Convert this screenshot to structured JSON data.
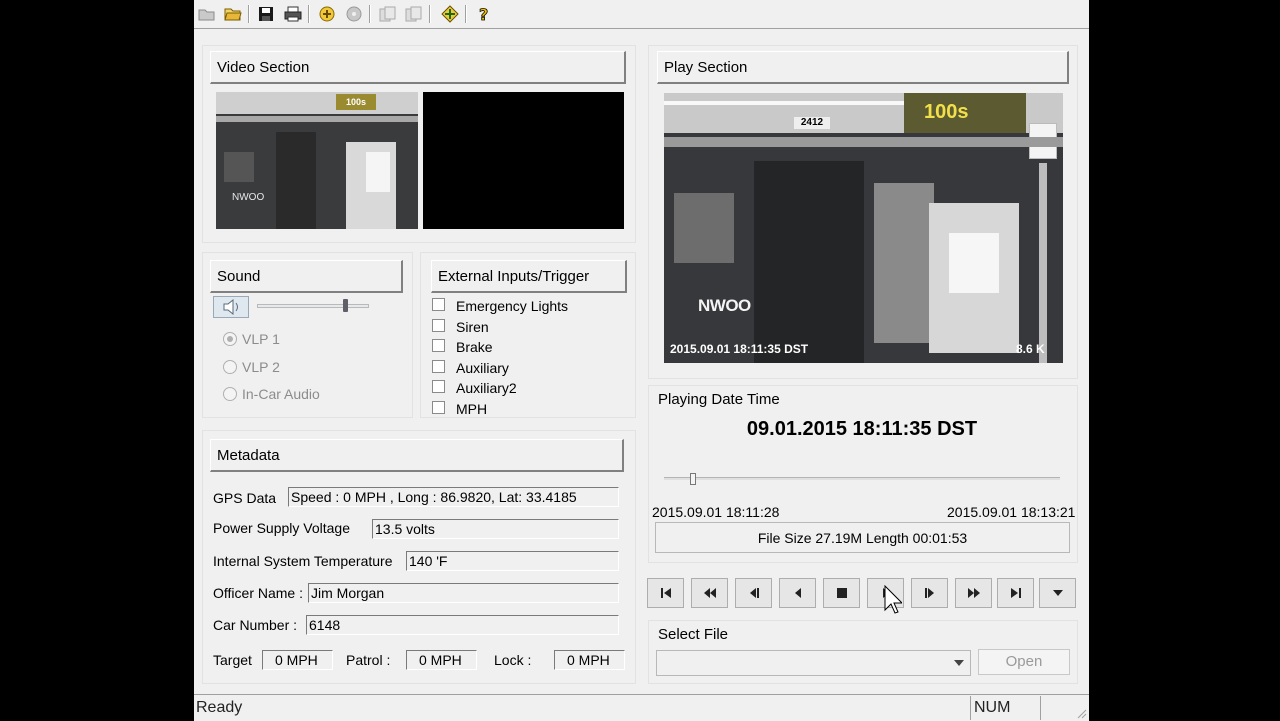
{
  "toolbar": {
    "icons": [
      "open-folder-icon",
      "open-file-icon",
      "save-icon",
      "print-icon",
      "export-icon",
      "burn-icon",
      "copy-icon",
      "paste-icon",
      "navigate-icon",
      "help-icon"
    ]
  },
  "video_section": {
    "title": "Video Section",
    "camera1_overlay": "NWOO",
    "camera1_sign": "100s"
  },
  "play_section": {
    "title": "Play Section",
    "overlay_text": "NWOO",
    "timestamp_overlay": "2015.09.01 18:11:35 DST",
    "rate_overlay": "8.6 K",
    "sign_text": "100s",
    "aisle_number": "2412"
  },
  "sound": {
    "title": "Sound",
    "volume": 0.78,
    "options": [
      "VLP 1",
      "VLP 2",
      "In-Car Audio"
    ],
    "selected": 0
  },
  "external_inputs": {
    "title": "External Inputs/Trigger",
    "items": [
      "Emergency Lights",
      "Siren",
      "Brake",
      "Auxiliary",
      "Auxiliary2",
      "MPH"
    ]
  },
  "metadata": {
    "title": "Metadata",
    "gps_label": "GPS Data",
    "gps_value": "Speed : 0 MPH , Long : 86.9820, Lat: 33.4185",
    "voltage_label": "Power Supply Voltage",
    "voltage_value": "13.5 volts",
    "temp_label": "Internal System Temperature",
    "temp_value": "140 'F",
    "officer_label": "Officer Name :",
    "officer_value": "Jim  Morgan",
    "car_label": "Car Number :",
    "car_value": "6148",
    "target_label": "Target",
    "target_value": "0 MPH",
    "patrol_label": "Patrol :",
    "patrol_value": "0 MPH",
    "lock_label": "Lock :",
    "lock_value": "0 MPH"
  },
  "playing": {
    "label": "Playing Date Time",
    "datetime": "09.01.2015 18:11:35 DST",
    "start": "2015.09.01 18:11:28",
    "end": "2015.09.01 18:13:21",
    "position": 0.07,
    "file_info": "File Size 27.19M   Length 00:01:53"
  },
  "controls": [
    "skip-to-start-icon",
    "rewind-icon",
    "step-back-icon",
    "play-reverse-icon",
    "stop-icon",
    "play-icon",
    "step-forward-icon",
    "fast-forward-icon",
    "skip-to-end-icon",
    "dropdown-icon"
  ],
  "select_file": {
    "label": "Select File",
    "value": "",
    "open_label": "Open"
  },
  "status": {
    "text": "Ready",
    "num": "NUM"
  }
}
